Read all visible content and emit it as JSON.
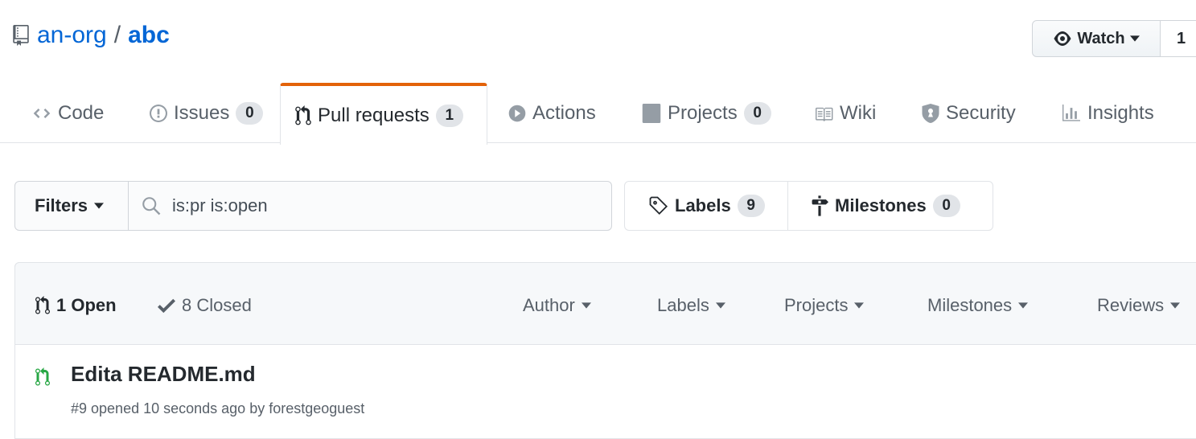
{
  "repo": {
    "owner": "an-org",
    "separator": "/",
    "name": "abc"
  },
  "watch": {
    "label": "Watch",
    "count": "1"
  },
  "tabs": [
    {
      "label": "Code",
      "icon": "code-icon",
      "counter": null
    },
    {
      "label": "Issues",
      "icon": "issue-icon",
      "counter": "0"
    },
    {
      "label": "Pull requests",
      "icon": "pull-request-icon",
      "counter": "1"
    },
    {
      "label": "Actions",
      "icon": "play-icon",
      "counter": null
    },
    {
      "label": "Projects",
      "icon": "project-icon",
      "counter": "0"
    },
    {
      "label": "Wiki",
      "icon": "book-icon",
      "counter": null
    },
    {
      "label": "Security",
      "icon": "shield-icon",
      "counter": null
    },
    {
      "label": "Insights",
      "icon": "graph-icon",
      "counter": null
    }
  ],
  "filters": {
    "button_label": "Filters",
    "search_value": "is:pr is:open",
    "labels_label": "Labels",
    "labels_count": "9",
    "milestones_label": "Milestones",
    "milestones_count": "0"
  },
  "list": {
    "open_label": "1 Open",
    "closed_label": "8 Closed",
    "dropdowns": [
      "Author",
      "Labels",
      "Projects",
      "Milestones",
      "Reviews"
    ]
  },
  "pull_requests": [
    {
      "title": "Edita README.md",
      "meta": "#9 opened 10 seconds ago by forestgeoguest"
    }
  ],
  "colors": {
    "link": "#0366d6",
    "active_tab_border": "#e36209",
    "open_pr": "#28a745"
  }
}
